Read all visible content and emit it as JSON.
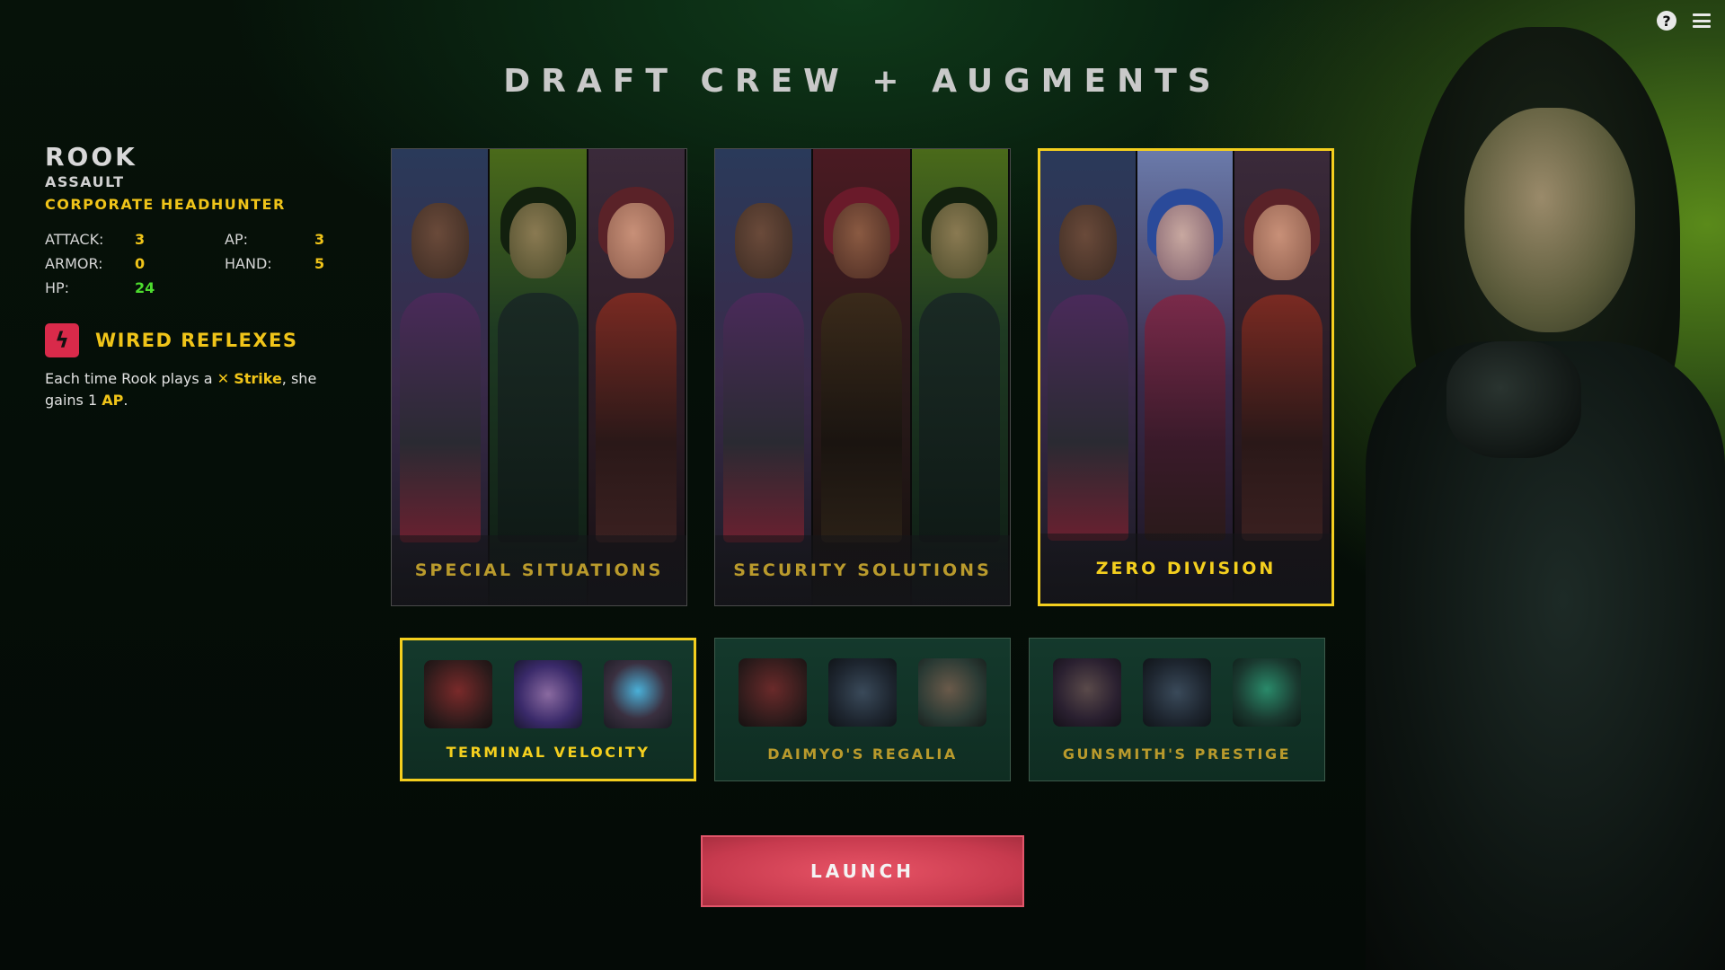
{
  "header": {
    "title": "DRAFT CREW + AUGMENTS"
  },
  "icons": {
    "help": "help-icon",
    "menu": "menu-icon",
    "ability": "lightning-icon"
  },
  "character": {
    "name": "ROOK",
    "role": "ASSAULT",
    "faction": "CORPORATE HEADHUNTER",
    "stats": {
      "attack_label": "ATTACK:",
      "attack": "3",
      "ap_label": "AP:",
      "ap": "3",
      "armor_label": "ARMOR:",
      "armor": "0",
      "hand_label": "HAND:",
      "hand": "5",
      "hp_label": "HP:",
      "hp": "24"
    },
    "ability": {
      "name": "WIRED REFLEXES",
      "desc_part1": "Each time Rook plays a ",
      "desc_icon": "✕",
      "desc_strike": "Strike",
      "desc_part2": ", she gains 1 ",
      "desc_ap": "AP",
      "desc_end": "."
    }
  },
  "crews": [
    {
      "label": "SPECIAL SITUATIONS",
      "selected": false
    },
    {
      "label": "SECURITY SOLUTIONS",
      "selected": false
    },
    {
      "label": "ZERO DIVISION",
      "selected": true
    }
  ],
  "augments": [
    {
      "label": "TERMINAL VELOCITY",
      "selected": true
    },
    {
      "label": "DAIMYO'S REGALIA",
      "selected": false
    },
    {
      "label": "GUNSMITH'S PRESTIGE",
      "selected": false
    }
  ],
  "launch": {
    "label": "LAUNCH"
  },
  "colors": {
    "accent_yellow": "#f4cf1e",
    "hp_green": "#4ddc2e",
    "launch_red": "#d94459",
    "ability_red": "#d92a4a"
  }
}
